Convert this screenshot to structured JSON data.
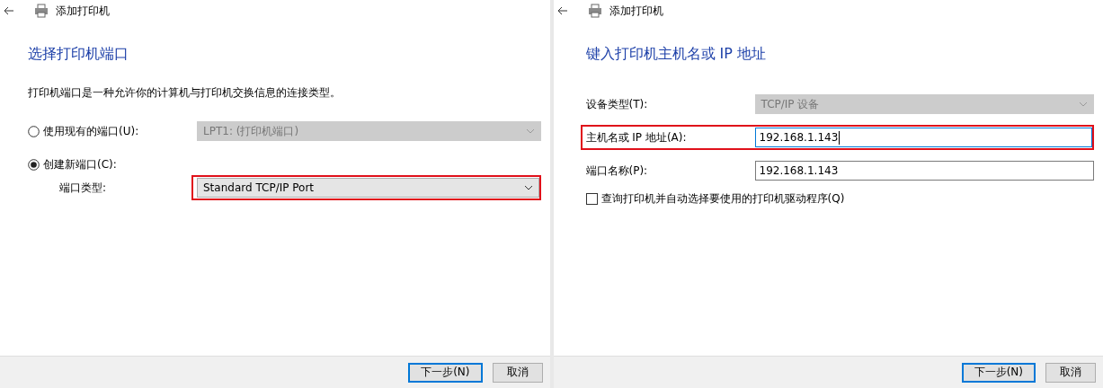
{
  "panels": [
    {
      "title": "添加打印机",
      "heading": "选择打印机端口",
      "description": "打印机端口是一种允许你的计算机与打印机交换信息的连接类型。",
      "rows": [
        {
          "kind": "radio",
          "label": "使用现有的端口(U):",
          "selected": false,
          "field": {
            "kind": "select",
            "value": "LPT1: (打印机端口)",
            "disabled": true,
            "highlighted": false
          }
        },
        {
          "kind": "radio",
          "label": "创建新端口(C):",
          "selected": true,
          "children": [
            {
              "kind": "field",
              "label": "端口类型:",
              "highlighted": false,
              "field": {
                "kind": "select",
                "value": "Standard TCP/IP Port",
                "disabled": false,
                "highlighted": true
              }
            }
          ]
        }
      ],
      "buttons": [
        {
          "label": "下一步(N)",
          "focused": true
        },
        {
          "label": "取消",
          "focused": false
        }
      ]
    },
    {
      "title": "添加打印机",
      "heading": "键入打印机主机名或 IP 地址",
      "rows": [
        {
          "kind": "field",
          "label": "设备类型(T):",
          "highlighted": false,
          "field": {
            "kind": "select",
            "value": "TCP/IP 设备",
            "disabled": true,
            "highlighted": false
          }
        },
        {
          "kind": "field",
          "label": "主机名或 IP 地址(A):",
          "highlighted": true,
          "field": {
            "kind": "input",
            "value": "192.168.1.143",
            "focused": true,
            "highlighted": false
          }
        },
        {
          "kind": "field",
          "label": "端口名称(P):",
          "highlighted": false,
          "field": {
            "kind": "input",
            "value": "192.168.1.143",
            "focused": false,
            "highlighted": false
          }
        },
        {
          "kind": "checkbox",
          "label": "查询打印机并自动选择要使用的打印机驱动程序(Q)",
          "checked": false
        }
      ],
      "buttons": [
        {
          "label": "下一步(N)",
          "focused": true
        },
        {
          "label": "取消",
          "focused": false
        }
      ]
    }
  ]
}
